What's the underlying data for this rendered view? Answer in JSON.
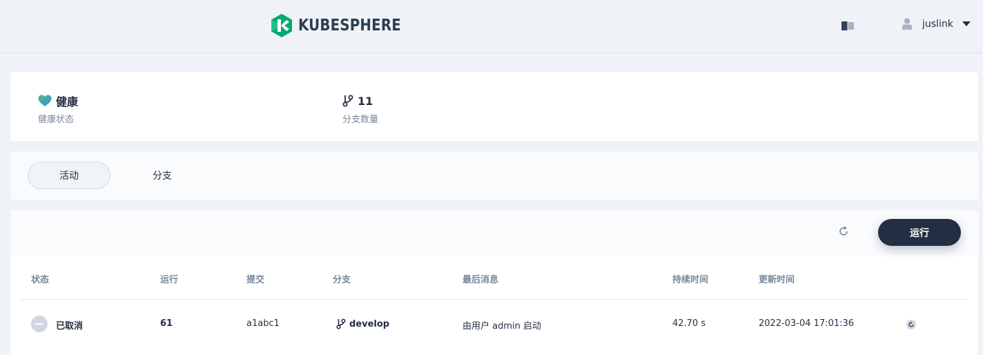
{
  "header": {
    "logo_text": "KUBESPHERE",
    "book_icon": "book-icon",
    "user_name": "juslink"
  },
  "overview": {
    "health_value": "健康",
    "health_label": "健康状态",
    "branch_count": "11",
    "branch_label": "分支数量"
  },
  "tabs": [
    {
      "label": "活动",
      "active": true
    },
    {
      "label": "分支",
      "active": false
    }
  ],
  "toolbar": {
    "run_label": "运行"
  },
  "table": {
    "columns": [
      "状态",
      "运行",
      "提交",
      "分支",
      "最后消息",
      "持续时间",
      "更新时间"
    ],
    "rows": [
      {
        "status": "已取消",
        "run": "61",
        "commit": "a1abc1",
        "branch": "develop",
        "message": "由用户 admin 启动",
        "duration": "42.70 s",
        "updated": "2022-03-04 17:01:36"
      }
    ]
  },
  "colors": {
    "accent_dark": "#242e42",
    "brand_green": "#00a971",
    "muted_text": "#79879c"
  }
}
